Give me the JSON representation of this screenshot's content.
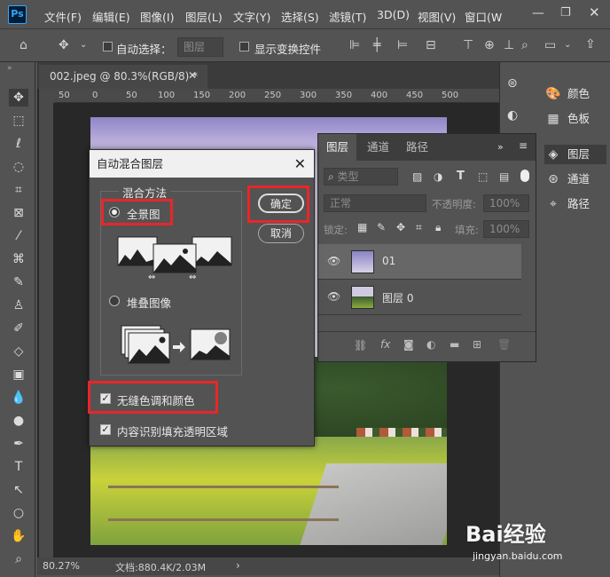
{
  "app": {
    "logo": "Ps"
  },
  "menu": [
    "文件(F)",
    "编辑(E)",
    "图像(I)",
    "图层(L)",
    "文字(Y)",
    "选择(S)",
    "滤镜(T)",
    "3D(D)",
    "视图(V)",
    "窗口(W"
  ],
  "options": {
    "auto_select_label": "自动选择：",
    "auto_select_value": "图层",
    "show_transform_label": "显示变换控件"
  },
  "document": {
    "tab_title": "002.jpeg @ 80.3%(RGB/8) *",
    "ruler_ticks": [
      "50",
      "0",
      "50",
      "100",
      "150",
      "200",
      "250",
      "300",
      "350",
      "400",
      "450",
      "500"
    ]
  },
  "status": {
    "zoom": "80.27%",
    "doc_info": "文档:880.4K/2.03M"
  },
  "right_panel": [
    "颜色",
    "色板",
    "图层",
    "通道",
    "路径"
  ],
  "layers_panel": {
    "tabs": [
      "图层",
      "通道",
      "路径"
    ],
    "filter_label": "类型",
    "blend_mode": "正常",
    "opacity_label": "不透明度:",
    "opacity_value": "100%",
    "lock_label": "锁定:",
    "fill_label": "填充:",
    "fill_value": "100%",
    "layers": [
      {
        "name": "01"
      },
      {
        "name": "图层 0"
      }
    ]
  },
  "dialog": {
    "title": "自动混合图层",
    "method_legend": "混合方法",
    "option_panorama": "全景图",
    "option_stack": "堆叠图像",
    "ok_button": "确定",
    "cancel_button": "取消",
    "seamless_label": "无缝色调和颜色",
    "content_aware_label": "内容识别填充透明区域"
  },
  "watermark": {
    "brand": "Bai经验",
    "url": "jingyan.baidu.com"
  },
  "colors": {
    "highlight": "#e8262a",
    "ui_bg": "#535353",
    "ps_blue": "#31a8ff"
  }
}
